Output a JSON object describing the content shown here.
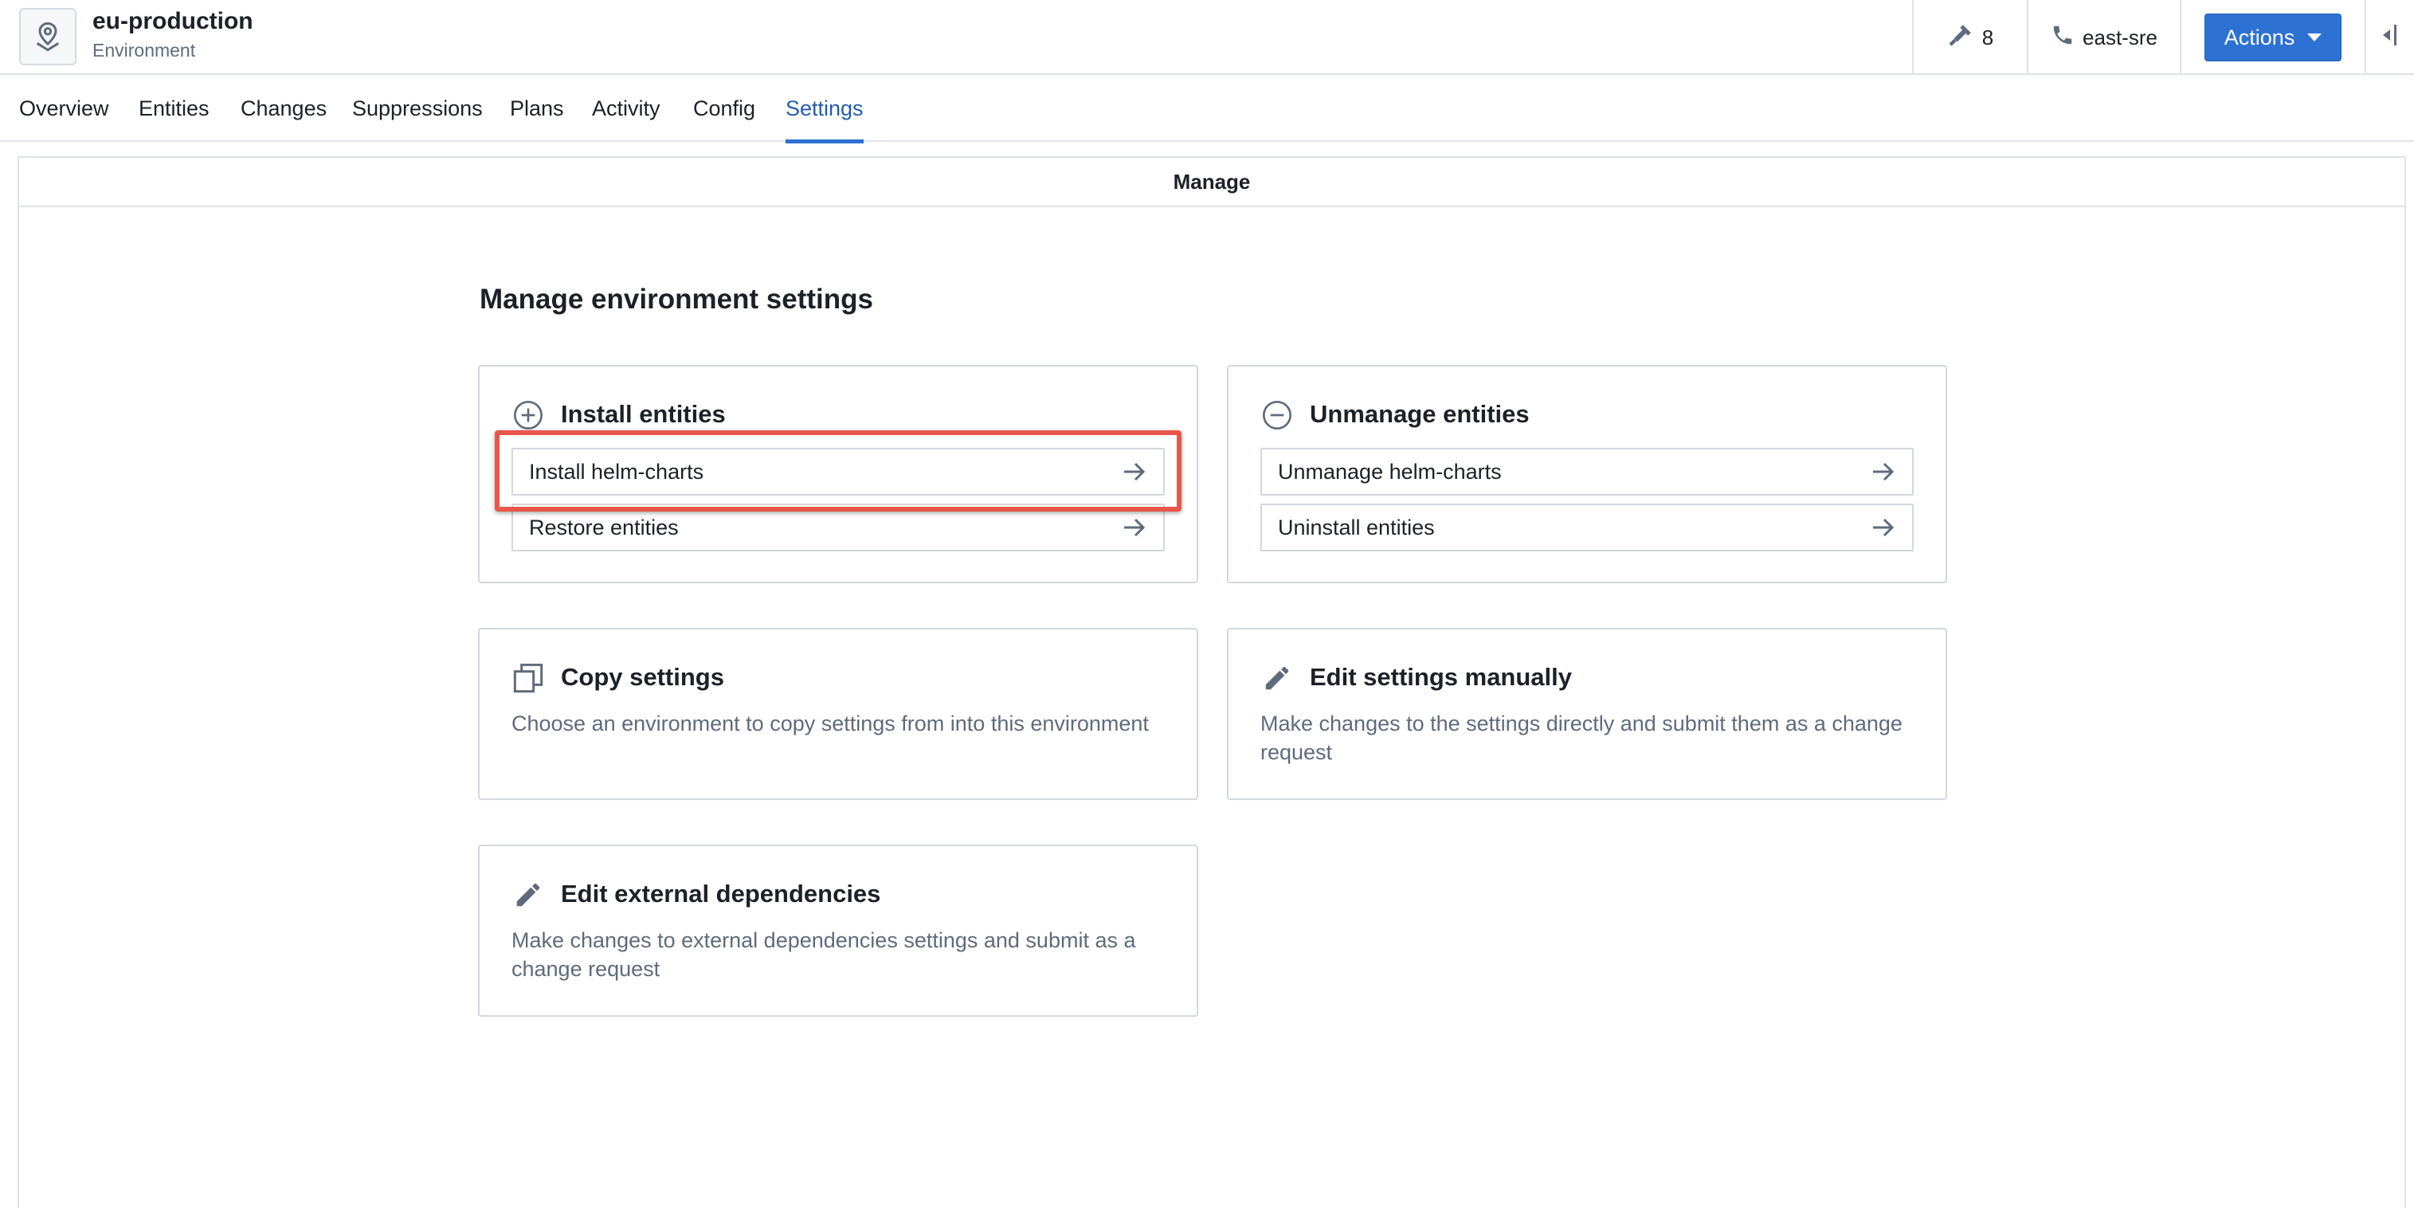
{
  "header": {
    "title": "eu-production",
    "subtitle": "Environment",
    "build_count": "8",
    "oncall_label": "east-sre",
    "actions_label": "Actions",
    "icons": {
      "environment": "map-pin-icon",
      "build": "hammer-icon",
      "oncall": "phone-icon",
      "actions_caret": "caret-down-icon",
      "collapse": "collapse-panel-icon"
    }
  },
  "tabs": [
    {
      "label": "Overview"
    },
    {
      "label": "Entities"
    },
    {
      "label": "Changes"
    },
    {
      "label": "Suppressions"
    },
    {
      "label": "Plans"
    },
    {
      "label": "Activity"
    },
    {
      "label": "Config"
    },
    {
      "label": "Settings",
      "active": true
    }
  ],
  "panel": {
    "title": "Manage",
    "section_title": "Manage environment settings"
  },
  "cards": {
    "install": {
      "title": "Install entities",
      "icon": "plus-circle-icon",
      "items": [
        {
          "label": "Install helm-charts",
          "highlighted": true
        },
        {
          "label": "Restore entities"
        }
      ]
    },
    "unmanage": {
      "title": "Unmanage entities",
      "icon": "minus-circle-icon",
      "items": [
        {
          "label": "Unmanage helm-charts"
        },
        {
          "label": "Uninstall entities"
        }
      ]
    },
    "copy": {
      "title": "Copy settings",
      "icon": "duplicate-icon",
      "description": "Choose an environment to copy settings from into this environment"
    },
    "edit_manual": {
      "title": "Edit settings manually",
      "icon": "edit-pencil-icon",
      "description": "Make changes to the settings directly and submit them as a change request"
    },
    "edit_external": {
      "title": "Edit external dependencies",
      "icon": "edit-pencil-icon",
      "description": "Make changes to external dependencies settings and submit as a change request"
    }
  },
  "colors": {
    "accent": "#2d72d2",
    "highlight": "#e8564a",
    "muted_text": "#5f6b7c",
    "border": "#d3d8de"
  }
}
